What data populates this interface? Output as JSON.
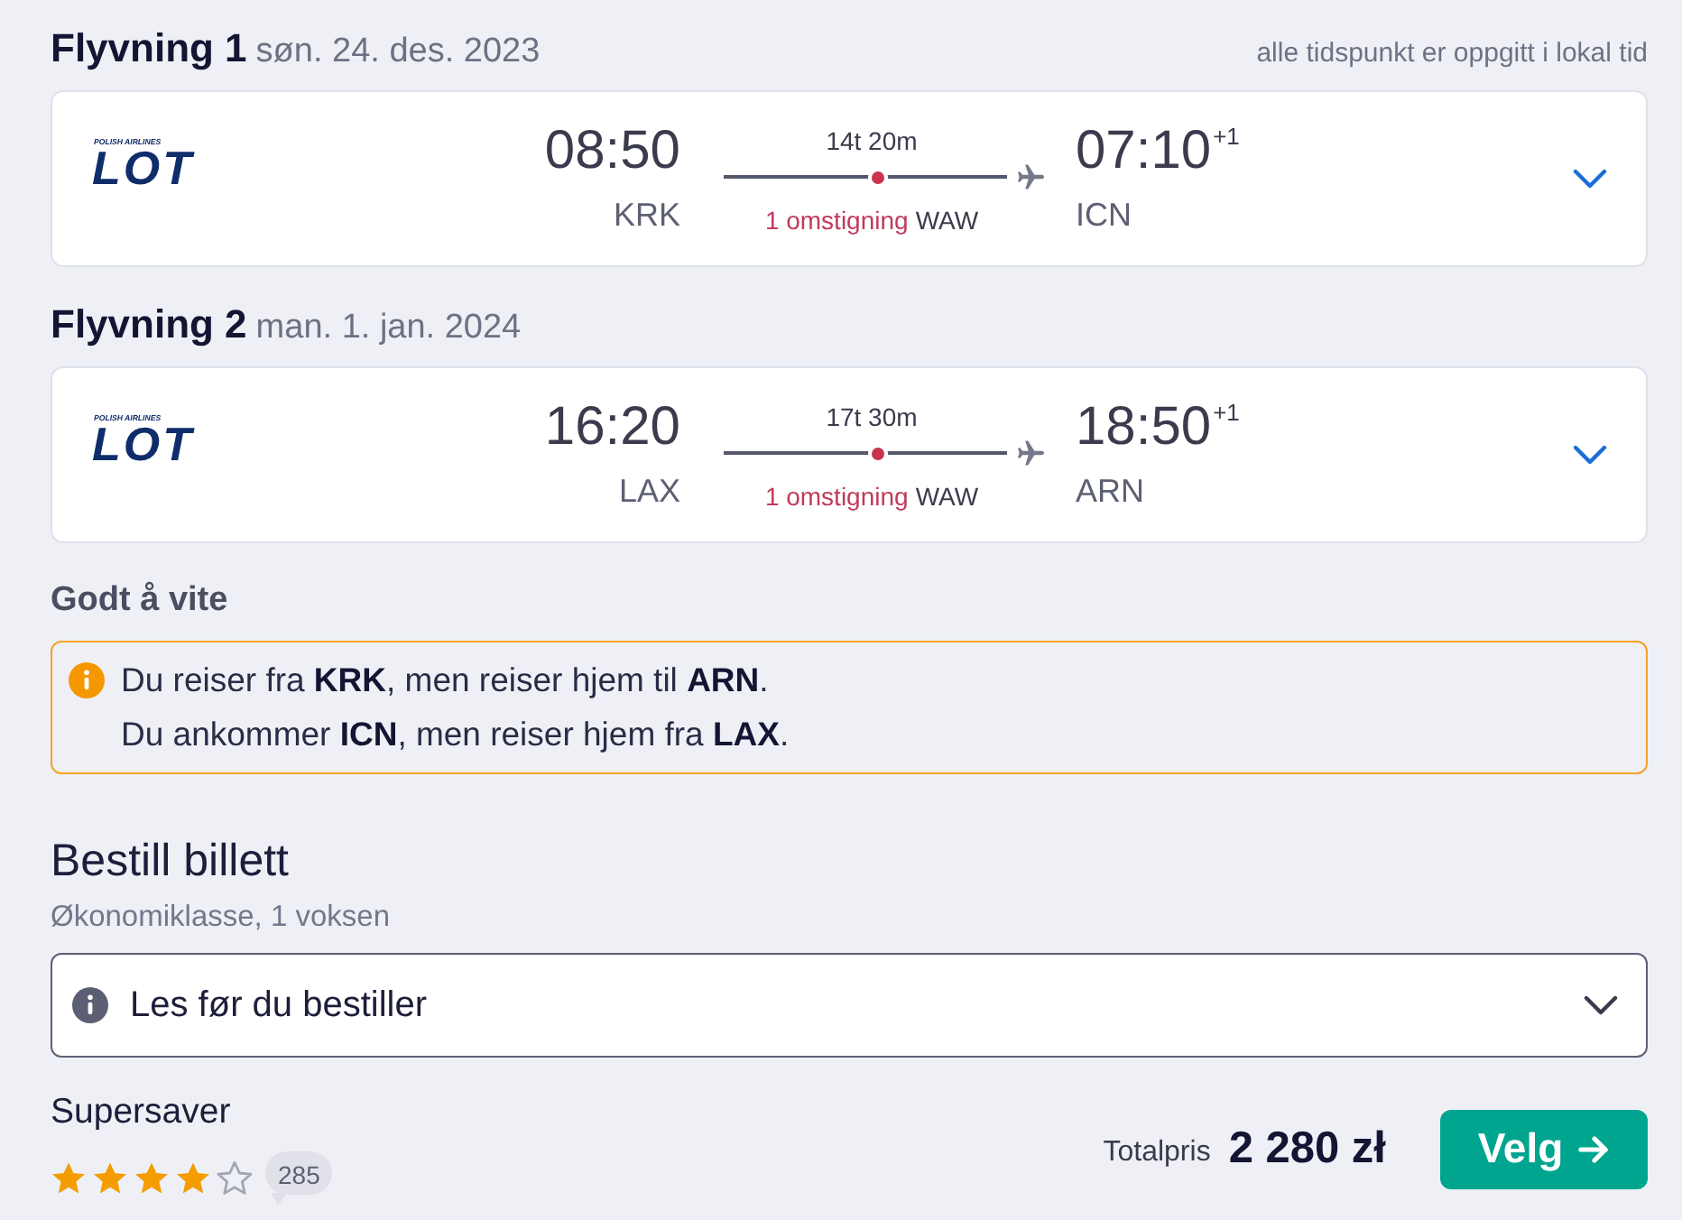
{
  "flights": [
    {
      "heading": "Flyvning 1",
      "date": "søn. 24. des. 2023",
      "note": "alle tidspunkt er oppgitt i lokal tid",
      "airline": {
        "caption": "POLISH AIRLINES",
        "name": "LOT"
      },
      "departure": {
        "time": "08:50",
        "airport": "KRK"
      },
      "duration": "14t 20m",
      "stops": "1 omstigning",
      "via": "WAW",
      "arrival": {
        "time": "07:10",
        "day_offset": "+1",
        "airport": "ICN"
      },
      "expanded": false
    },
    {
      "heading": "Flyvning 2",
      "date": "man. 1. jan. 2024",
      "airline": {
        "caption": "POLISH AIRLINES",
        "name": "LOT"
      },
      "departure": {
        "time": "16:20",
        "airport": "LAX"
      },
      "duration": "17t 30m",
      "stops": "1 omstigning",
      "via": "WAW",
      "arrival": {
        "time": "18:50",
        "day_offset": "+1",
        "airport": "ARN"
      },
      "expanded": false
    }
  ],
  "good_to_know": {
    "title": "Godt å vite",
    "lines": [
      "Du reiser fra **KRK**, men reiser hjem til **ARN**.",
      "Du ankommer **ICN**, men reiser hjem fra **LAX**."
    ]
  },
  "booking": {
    "title": "Bestill billett",
    "subtitle": "Økonomiklasse, 1 voksen",
    "info_dropdown": {
      "label": "Les før du bestiller",
      "expanded": false
    },
    "fare": {
      "name": "Supersaver",
      "stars": 4,
      "reviews": "285"
    },
    "total_label": "Totalpris",
    "total": "2 280 zł",
    "select_button": "Velg"
  }
}
